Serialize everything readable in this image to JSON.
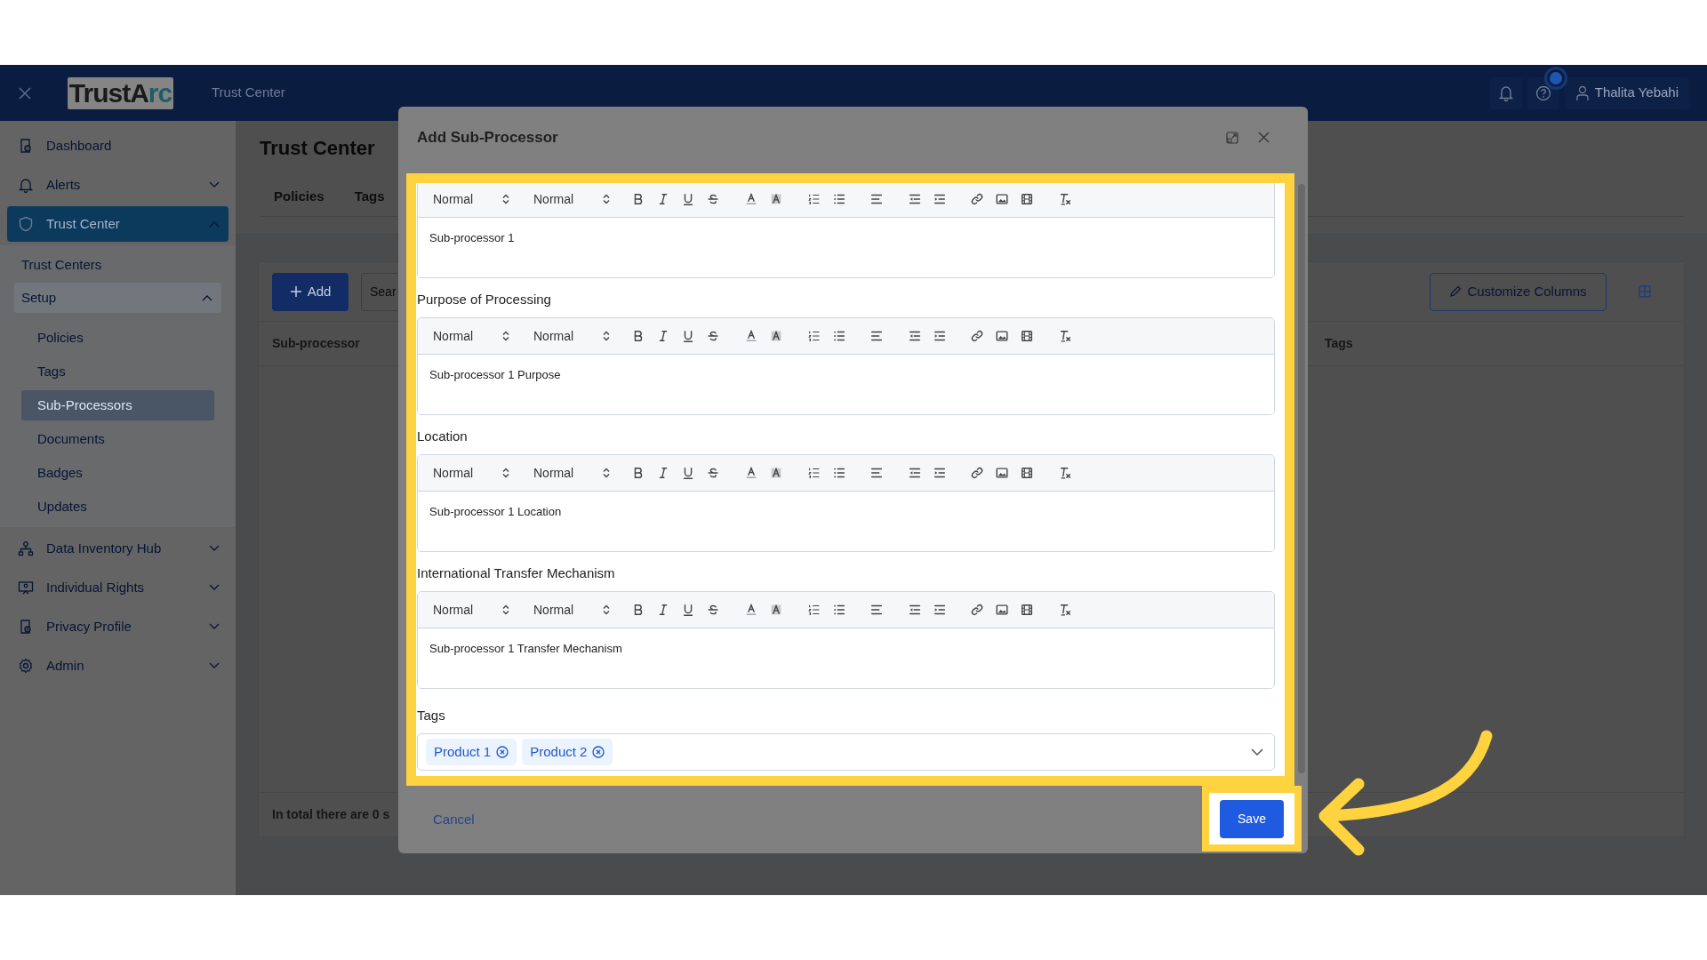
{
  "header": {
    "logo": {
      "text": "TrustA",
      "accent": "rc"
    },
    "title": "Trust Center",
    "user": "Thalita Yebahi"
  },
  "sidebar": {
    "items": [
      {
        "label": "Dashboard",
        "selected": false
      },
      {
        "label": "Alerts",
        "selected": false,
        "expanded": false
      },
      {
        "label": "Trust Center",
        "selected": true,
        "expanded": true,
        "children": [
          {
            "label": "Trust Centers",
            "selected": false
          },
          {
            "label": "Setup",
            "selected": false,
            "expanded": true,
            "children": [
              {
                "label": "Policies",
                "selected": false
              },
              {
                "label": "Tags",
                "selected": false
              },
              {
                "label": "Sub-Processors",
                "selected": true
              },
              {
                "label": "Documents",
                "selected": false
              },
              {
                "label": "Badges",
                "selected": false
              },
              {
                "label": "Updates",
                "selected": false
              }
            ]
          }
        ]
      },
      {
        "label": "Data Inventory Hub",
        "selected": false,
        "expanded": false
      },
      {
        "label": "Individual Rights",
        "selected": false,
        "expanded": false
      },
      {
        "label": "Privacy Profile",
        "selected": false,
        "expanded": false
      },
      {
        "label": "Admin",
        "selected": false,
        "expanded": false
      }
    ]
  },
  "page": {
    "title": "Trust Center",
    "tabs": [
      {
        "label": "Policies",
        "selected": false
      },
      {
        "label": "Tags",
        "selected": false
      }
    ],
    "add_button": "Add",
    "search": {
      "placeholder": "Sear"
    },
    "customize_button": "Customize Columns",
    "table": {
      "columns": [
        "Sub-processor",
        "Tags"
      ]
    },
    "footer": "In total there are 0 s"
  },
  "modal": {
    "title": "Add Sub-Processor",
    "editors": [
      {
        "toolbar": [
          "Normal",
          "Normal"
        ],
        "value": "Sub-processor 1"
      },
      {
        "label": "Purpose of Processing",
        "toolbar": [
          "Normal",
          "Normal"
        ],
        "value": "Sub-processor 1 Purpose"
      },
      {
        "label": "Location",
        "toolbar": [
          "Normal",
          "Normal"
        ],
        "value": "Sub-processor 1 Location"
      },
      {
        "label": "International Transfer Mechanism",
        "toolbar": [
          "Normal",
          "Normal"
        ],
        "value": "Sub-processor 1 Transfer Mechanism"
      }
    ],
    "tags": {
      "label": "Tags",
      "values": [
        "Product 1",
        "Product 2"
      ]
    },
    "cancel": "Cancel",
    "save": "Save"
  }
}
